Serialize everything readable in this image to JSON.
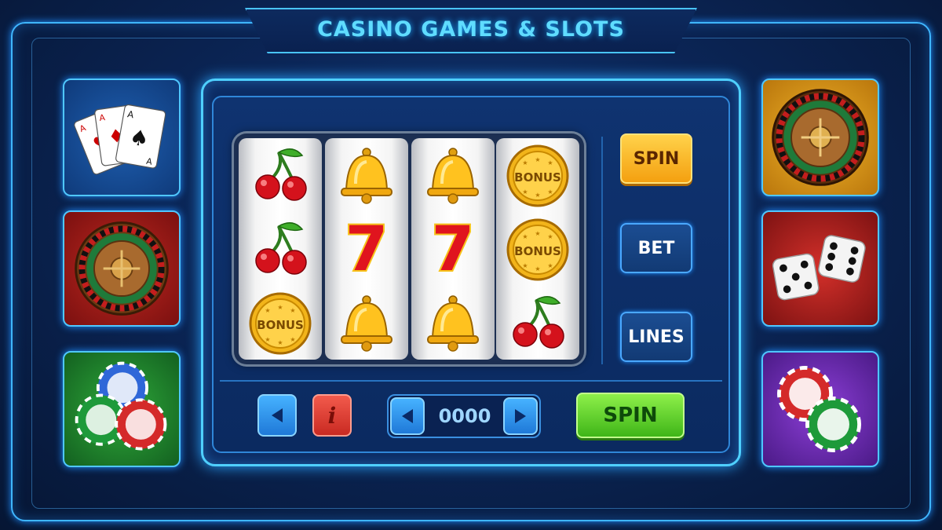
{
  "header": {
    "title": "CASINO GAMES & SLOTS"
  },
  "game_tiles": {
    "left": [
      {
        "name": "playing-cards",
        "icon": "playing-cards-icon"
      },
      {
        "name": "roulette",
        "icon": "roulette-wheel-icon"
      },
      {
        "name": "poker-chips",
        "icon": "poker-chips-icon"
      }
    ],
    "right": [
      {
        "name": "roulette",
        "icon": "roulette-wheel-icon"
      },
      {
        "name": "dice",
        "icon": "dice-icon"
      },
      {
        "name": "poker-chips",
        "icon": "poker-chips-icon"
      }
    ]
  },
  "reels": [
    {
      "symbols": [
        "cherry",
        "cherry",
        "bonus-coin"
      ]
    },
    {
      "symbols": [
        "bell",
        "seven",
        "bell"
      ]
    },
    {
      "symbols": [
        "bell",
        "seven",
        "bell"
      ]
    },
    {
      "symbols": [
        "bonus-coin",
        "bonus-coin",
        "cherry"
      ]
    }
  ],
  "symbol_text": {
    "bonus": "BONUS",
    "seven": "7"
  },
  "side_buttons": {
    "spin": "SPIN",
    "bet": "BET",
    "lines": "LINES"
  },
  "controls": {
    "back_icon": "back-arrow-icon",
    "info_label": "i",
    "counter_value": "0000",
    "spin_label": "SPIN"
  },
  "colors": {
    "accent_cyan": "#4fd0ff",
    "spin_orange": "#f4a010",
    "spin_green": "#3fb518",
    "info_red": "#c92a22",
    "panel_blue": "#0c2b63"
  }
}
